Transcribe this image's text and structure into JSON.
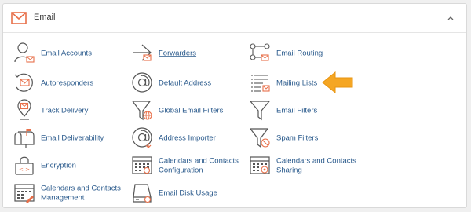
{
  "header": {
    "title": "Email"
  },
  "items": [
    {
      "label": "Email Accounts",
      "icon": "email-accounts-icon"
    },
    {
      "label": "Forwarders",
      "icon": "forwarders-icon",
      "link": true
    },
    {
      "label": "Email Routing",
      "icon": "email-routing-icon"
    },
    {
      "label": "Autoresponders",
      "icon": "autoresponders-icon"
    },
    {
      "label": "Default Address",
      "icon": "default-address-icon"
    },
    {
      "label": "Mailing Lists",
      "icon": "mailing-lists-icon"
    },
    {
      "label": "Track Delivery",
      "icon": "track-delivery-icon"
    },
    {
      "label": "Global Email Filters",
      "icon": "global-email-filters-icon"
    },
    {
      "label": "Email Filters",
      "icon": "email-filters-icon"
    },
    {
      "label": "Email Deliverability",
      "icon": "email-deliverability-icon"
    },
    {
      "label": "Address Importer",
      "icon": "address-importer-icon"
    },
    {
      "label": "Spam Filters",
      "icon": "spam-filters-icon"
    },
    {
      "label": "Encryption",
      "icon": "encryption-icon"
    },
    {
      "label": "Calendars and Contacts Configuration",
      "icon": "calendars-contacts-configuration-icon"
    },
    {
      "label": "Calendars and Contacts Sharing",
      "icon": "calendars-contacts-sharing-icon"
    },
    {
      "label": "Calendars and Contacts Management",
      "icon": "calendars-contacts-management-icon"
    },
    {
      "label": "Email Disk Usage",
      "icon": "email-disk-usage-icon"
    }
  ],
  "colors": {
    "link": "#2a5a8c",
    "icon_stroke": "#555555",
    "accent": "#e8704a",
    "arrow": "#f5a623"
  }
}
